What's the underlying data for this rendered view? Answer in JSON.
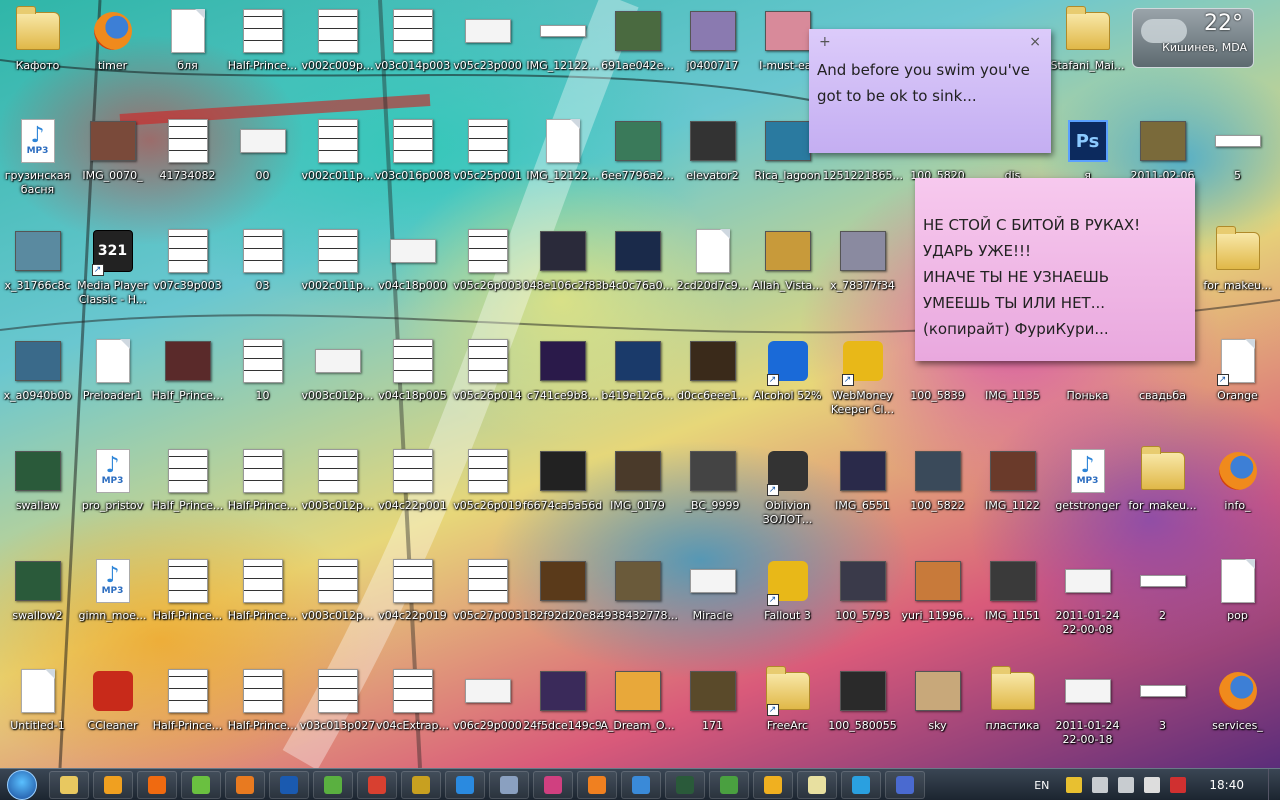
{
  "desktop": {
    "rows": [
      [
        {
          "l": "Кафото",
          "t": "folder"
        },
        {
          "l": "timer",
          "t": "firefox"
        },
        {
          "l": "бля",
          "t": "doc"
        },
        {
          "l": "Half-Prince...",
          "t": "manga"
        },
        {
          "l": "v002c009p...",
          "t": "manga"
        },
        {
          "l": "v03c014p003",
          "t": "manga"
        },
        {
          "l": "v05c23p000",
          "t": "wide"
        },
        {
          "l": "IMG_12122...",
          "t": "flat"
        },
        {
          "l": "691ae042e...",
          "t": "photo",
          "c": "#4a6a40"
        },
        {
          "l": "j0400717",
          "t": "photo",
          "c": "#8a7ab0"
        },
        {
          "l": "I-must-eat",
          "t": "photo",
          "c": "#d88a9a"
        },
        {
          "l": "",
          "t": "none"
        },
        {
          "l": "",
          "t": "none"
        },
        {
          "l": "",
          "t": "none"
        },
        {
          "l": "Stafani_Mai...",
          "t": "folder"
        },
        {
          "l": "",
          "t": "none"
        }
      ],
      [
        {
          "l": "грузинская басня",
          "t": "mp3"
        },
        {
          "l": "IMG_0070_",
          "t": "photo",
          "c": "#7a4a3a"
        },
        {
          "l": "41734082",
          "t": "manga"
        },
        {
          "l": "00",
          "t": "wide"
        },
        {
          "l": "v002c011p...",
          "t": "manga"
        },
        {
          "l": "v03c016p008",
          "t": "manga"
        },
        {
          "l": "v05c25p001",
          "t": "manga"
        },
        {
          "l": "IMG_12122...",
          "t": "doc"
        },
        {
          "l": "6ee7796a2...",
          "t": "photo",
          "c": "#3a7a5a"
        },
        {
          "l": "elevator2",
          "t": "photo",
          "c": "#333"
        },
        {
          "l": "Rica_lagoon",
          "t": "photo",
          "c": "#2a7aa0"
        },
        {
          "l": "1251221865...",
          "t": "none"
        },
        {
          "l": "100_5820",
          "t": "none"
        },
        {
          "l": "dis",
          "t": "none"
        },
        {
          "l": "я",
          "t": "ps"
        },
        {
          "l": "2011-02-06",
          "t": "photo",
          "c": "#7a6a3a"
        },
        {
          "l": "5",
          "t": "flat"
        }
      ],
      [
        {
          "l": "x_31766c8c",
          "t": "photo",
          "c": "#5a8aa0"
        },
        {
          "l": "Media Player Classic - H...",
          "t": "mpc",
          "s": 1
        },
        {
          "l": "v07c39p003",
          "t": "manga"
        },
        {
          "l": "03",
          "t": "manga"
        },
        {
          "l": "v002c011p...",
          "t": "manga"
        },
        {
          "l": "v04c18p000",
          "t": "wide"
        },
        {
          "l": "v05c26p003",
          "t": "manga"
        },
        {
          "l": "048e106c2f83",
          "t": "photo",
          "c": "#2a2a3a"
        },
        {
          "l": "b4c0c76a0...",
          "t": "photo",
          "c": "#1a2a4a"
        },
        {
          "l": "2cd20d7c9...",
          "t": "doc"
        },
        {
          "l": "Allah_Vista...",
          "t": "photo",
          "c": "#c89a3a"
        },
        {
          "l": "x_78377f34",
          "t": "photo",
          "c": "#8a8aa0"
        },
        {
          "l": "",
          "t": "none"
        },
        {
          "l": "",
          "t": "none"
        },
        {
          "l": "",
          "t": "none"
        },
        {
          "l": "",
          "t": "none"
        },
        {
          "l": "for_makeu...",
          "t": "folder"
        }
      ],
      [
        {
          "l": "x_a0940b0b",
          "t": "photo",
          "c": "#3a6a8a"
        },
        {
          "l": "Preloader1",
          "t": "doc"
        },
        {
          "l": "Half_Prince...",
          "t": "photo",
          "c": "#5a2a2a"
        },
        {
          "l": "10",
          "t": "manga"
        },
        {
          "l": "v003c012p...",
          "t": "wide"
        },
        {
          "l": "v04c18p005",
          "t": "manga"
        },
        {
          "l": "v05c26p014",
          "t": "manga"
        },
        {
          "l": "c741ce9b8...",
          "t": "photo",
          "c": "#2a1a4a"
        },
        {
          "l": "b419e12c6...",
          "t": "photo",
          "c": "#1a3a6a"
        },
        {
          "l": "d0cc6eee1...",
          "t": "photo",
          "c": "#3a2a1a"
        },
        {
          "l": "Alcohol 52%",
          "t": "gen",
          "c": "#1a6ad8",
          "s": 1
        },
        {
          "l": "WebMoney Keeper Cl...",
          "t": "gen",
          "c": "#e8b818",
          "s": 1
        },
        {
          "l": "100_5839",
          "t": "none"
        },
        {
          "l": "IMG_1135",
          "t": "none"
        },
        {
          "l": "Понька",
          "t": "none"
        },
        {
          "l": "свадьба",
          "t": "none"
        },
        {
          "l": "Orange",
          "t": "doc",
          "s": 1
        }
      ],
      [
        {
          "l": "swallaw",
          "t": "photo",
          "c": "#2a5a3a"
        },
        {
          "l": "pro_pristov",
          "t": "mp3"
        },
        {
          "l": "Half_Prince...",
          "t": "manga"
        },
        {
          "l": "Half-Prince...",
          "t": "manga"
        },
        {
          "l": "v003c012p...",
          "t": "manga"
        },
        {
          "l": "v04c22p001",
          "t": "manga"
        },
        {
          "l": "v05c26p019",
          "t": "manga"
        },
        {
          "l": "f6674ca5a56d",
          "t": "photo",
          "c": "#222"
        },
        {
          "l": "IMG_0179",
          "t": "photo",
          "c": "#4a3a2a"
        },
        {
          "l": "_BC_9999",
          "t": "photo",
          "c": "#444"
        },
        {
          "l": "Oblivion ЗОЛОТ...",
          "t": "gen",
          "c": "#333",
          "s": 1
        },
        {
          "l": "IMG_6551",
          "t": "photo",
          "c": "#2a2a4a"
        },
        {
          "l": "100_5822",
          "t": "photo",
          "c": "#3a4a5a"
        },
        {
          "l": "IMG_1122",
          "t": "photo",
          "c": "#6a3a2a"
        },
        {
          "l": "getstronger",
          "t": "mp3"
        },
        {
          "l": "for_makeu...",
          "t": "folder"
        },
        {
          "l": "info_",
          "t": "firefox"
        }
      ],
      [
        {
          "l": "swallow2",
          "t": "photo",
          "c": "#2a5a3a"
        },
        {
          "l": "gimn_moe...",
          "t": "mp3"
        },
        {
          "l": "Half-Prince...",
          "t": "manga"
        },
        {
          "l": "Half-Prince...",
          "t": "manga"
        },
        {
          "l": "v003c012p...",
          "t": "manga"
        },
        {
          "l": "v04c22p019",
          "t": "manga"
        },
        {
          "l": "v05c27p003",
          "t": "manga"
        },
        {
          "l": "182f92d20e8a",
          "t": "photo",
          "c": "#5a3a1a"
        },
        {
          "l": "4938432778...",
          "t": "photo",
          "c": "#6a5a3a"
        },
        {
          "l": "Miracle",
          "t": "wide"
        },
        {
          "l": "Fallout 3",
          "t": "gen",
          "c": "#e8b818",
          "s": 1
        },
        {
          "l": "100_5793",
          "t": "photo",
          "c": "#3a3a4a"
        },
        {
          "l": "yuri_11996...",
          "t": "photo",
          "c": "#c87a3a"
        },
        {
          "l": "IMG_1151",
          "t": "photo",
          "c": "#3a3a3a"
        },
        {
          "l": "2011-01-24 22-00-08",
          "t": "wide"
        },
        {
          "l": "2",
          "t": "flat"
        },
        {
          "l": "pop",
          "t": "doc"
        }
      ],
      [
        {
          "l": "Untitled-1",
          "t": "doc"
        },
        {
          "l": "CCleaner",
          "t": "gen",
          "c": "#c82a1a"
        },
        {
          "l": "Half-Prince...",
          "t": "manga"
        },
        {
          "l": "Half-Prince...",
          "t": "manga"
        },
        {
          "l": "v03c013p027",
          "t": "manga"
        },
        {
          "l": "v04cExtrap...",
          "t": "manga"
        },
        {
          "l": "v06c29p000",
          "t": "wide"
        },
        {
          "l": "24f5dce149c9",
          "t": "photo",
          "c": "#3a2a5a"
        },
        {
          "l": "A_Dream_O...",
          "t": "photo",
          "c": "#e8a83a"
        },
        {
          "l": "171",
          "t": "photo",
          "c": "#5a4a2a"
        },
        {
          "l": "FreeArc",
          "t": "folder",
          "s": 1
        },
        {
          "l": "100_580055",
          "t": "photo",
          "c": "#2a2a2a"
        },
        {
          "l": "sky",
          "t": "photo",
          "c": "#c8a87a"
        },
        {
          "l": "пластика",
          "t": "folder"
        },
        {
          "l": "2011-01-24 22-00-18",
          "t": "wide"
        },
        {
          "l": "3",
          "t": "flat"
        },
        {
          "l": "services_",
          "t": "firefox"
        }
      ]
    ]
  },
  "notes": {
    "purple": {
      "text": "And before you swim you've\ngot to be ok to sink...",
      "add": "+",
      "close": "×"
    },
    "pink": {
      "text": "НЕ СТОЙ С БИТОЙ В РУКАХ!\nУДАРЬ УЖЕ!!!\nИНАЧЕ ТЫ НЕ УЗНАЕШЬ\nУМЕЕШЬ ТЫ ИЛИ НЕТ...\n(копирайт) ФуриКури..."
    }
  },
  "weather": {
    "temp": "22°",
    "city": "Кишинев, MDA"
  },
  "taskbar": {
    "lang": "EN",
    "time": "18:40",
    "buttons": [
      {
        "n": "explorer",
        "c": "#e8c860"
      },
      {
        "n": "media-player",
        "c": "#f0a020"
      },
      {
        "n": "app-orange",
        "c": "#f06a10"
      },
      {
        "n": "network",
        "c": "#6ac040"
      },
      {
        "n": "firefox",
        "c": "#e87a20"
      },
      {
        "n": "photoshop",
        "c": "#1a5ab0"
      },
      {
        "n": "refresh-app",
        "c": "#5ab040"
      },
      {
        "n": "chrome",
        "c": "#d84030"
      },
      {
        "n": "fireworks",
        "c": "#c8a020"
      },
      {
        "n": "internet-explorer",
        "c": "#2a8ae0"
      },
      {
        "n": "tool",
        "c": "#8aa0c0"
      },
      {
        "n": "paint",
        "c": "#d04080"
      },
      {
        "n": "settings-app",
        "c": "#f08020"
      },
      {
        "n": "dropbox",
        "c": "#3a8ad8"
      },
      {
        "n": "audition",
        "c": "#2a5a3a"
      },
      {
        "n": "utorrent",
        "c": "#4aa040"
      },
      {
        "n": "winamp",
        "c": "#f0b020"
      },
      {
        "n": "sticky-notes",
        "c": "#e8e0a0"
      },
      {
        "n": "skype",
        "c": "#2aa0e0"
      },
      {
        "n": "mail",
        "c": "#4a6ad0"
      }
    ]
  }
}
